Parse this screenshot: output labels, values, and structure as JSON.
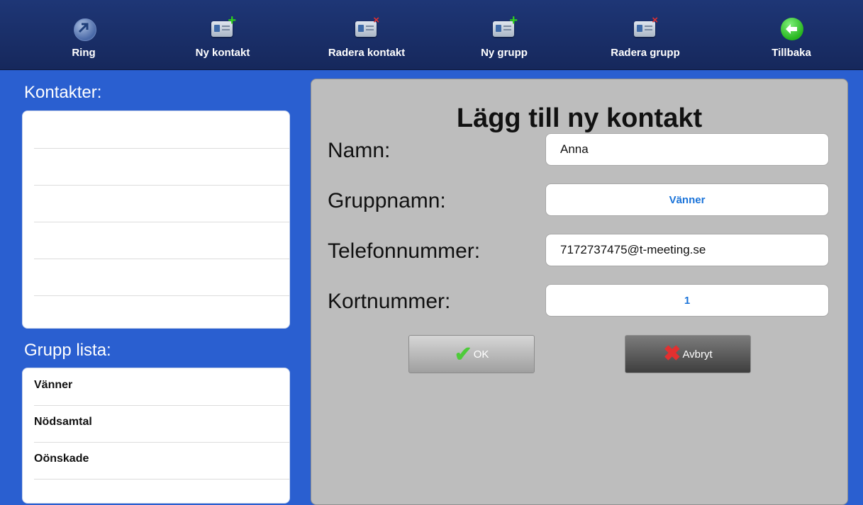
{
  "toolbar": {
    "items": [
      {
        "label": "Ring",
        "icon": "phone-call-icon"
      },
      {
        "label": "Ny kontakt",
        "icon": "add-contact-icon"
      },
      {
        "label": "Radera kontakt",
        "icon": "delete-contact-icon"
      },
      {
        "label": "Ny grupp",
        "icon": "add-group-icon"
      },
      {
        "label": "Radera grupp",
        "icon": "delete-group-icon"
      },
      {
        "label": "Tillbaka",
        "icon": "back-arrow-icon"
      }
    ]
  },
  "sidebar": {
    "contacts_title": "Kontakter:",
    "groups_title": "Grupp lista:",
    "groups": [
      "Vänner",
      "Nödsamtal",
      "Oönskade"
    ]
  },
  "dialog": {
    "title": "Lägg till ny kontakt",
    "name_label": "Namn:",
    "name_value": "Anna",
    "group_label": "Gruppnamn:",
    "group_value": "Vänner",
    "phone_label": "Telefonnummer:",
    "phone_value": "7172737475@t-meeting.se",
    "shortnum_label": "Kortnummer:",
    "shortnum_value": "1",
    "ok_label": "OK",
    "cancel_label": "Avbryt"
  },
  "colors": {
    "toolbar_bg": "#1e3676",
    "page_bg": "#2a5fd0",
    "panel_bg": "#bdbdbd",
    "select_text": "#1a73d9"
  }
}
